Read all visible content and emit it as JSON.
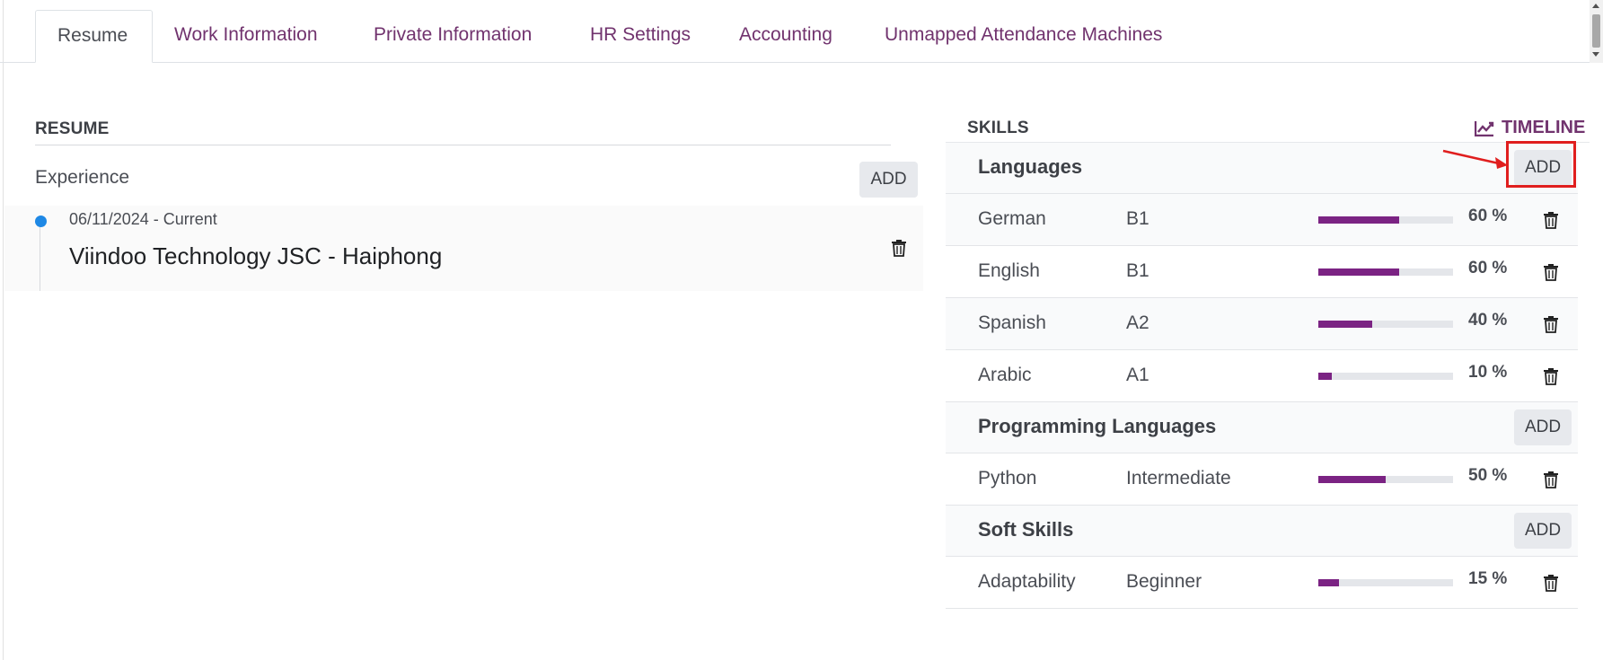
{
  "tabs": [
    {
      "label": "Resume",
      "active": true
    },
    {
      "label": "Work Information"
    },
    {
      "label": "Private Information"
    },
    {
      "label": "HR Settings"
    },
    {
      "label": "Accounting"
    },
    {
      "label": "Unmapped Attendance Machines"
    }
  ],
  "resume": {
    "title": "RESUME",
    "experience_label": "Experience",
    "add_label": "ADD",
    "lines": [
      {
        "date": "06/11/2024 - Current",
        "name": "Viindoo Technology JSC - Haiphong"
      }
    ]
  },
  "skills": {
    "title": "SKILLS",
    "timeline_label": "TIMELINE",
    "add_label": "ADD",
    "groups": [
      {
        "name": "Languages",
        "items": [
          {
            "name": "German",
            "level": "B1",
            "progress": 60,
            "pct": "60 %"
          },
          {
            "name": "English",
            "level": "B1",
            "progress": 60,
            "pct": "60 %"
          },
          {
            "name": "Spanish",
            "level": "A2",
            "progress": 40,
            "pct": "40 %"
          },
          {
            "name": "Arabic",
            "level": "A1",
            "progress": 10,
            "pct": "10 %"
          }
        ]
      },
      {
        "name": "Programming Languages",
        "items": [
          {
            "name": "Python",
            "level": "Intermediate",
            "progress": 50,
            "pct": "50 %"
          }
        ]
      },
      {
        "name": "Soft Skills",
        "items": [
          {
            "name": "Adaptability",
            "level": "Beginner",
            "progress": 15,
            "pct": "15 %"
          }
        ]
      }
    ]
  },
  "colors": {
    "accent": "#71336e",
    "bar": "#7b2383",
    "dot": "#1e88e5",
    "highlight": "#e01e1e"
  },
  "icons": [
    "trash-icon",
    "chart-line-icon",
    "annotation-arrow"
  ]
}
